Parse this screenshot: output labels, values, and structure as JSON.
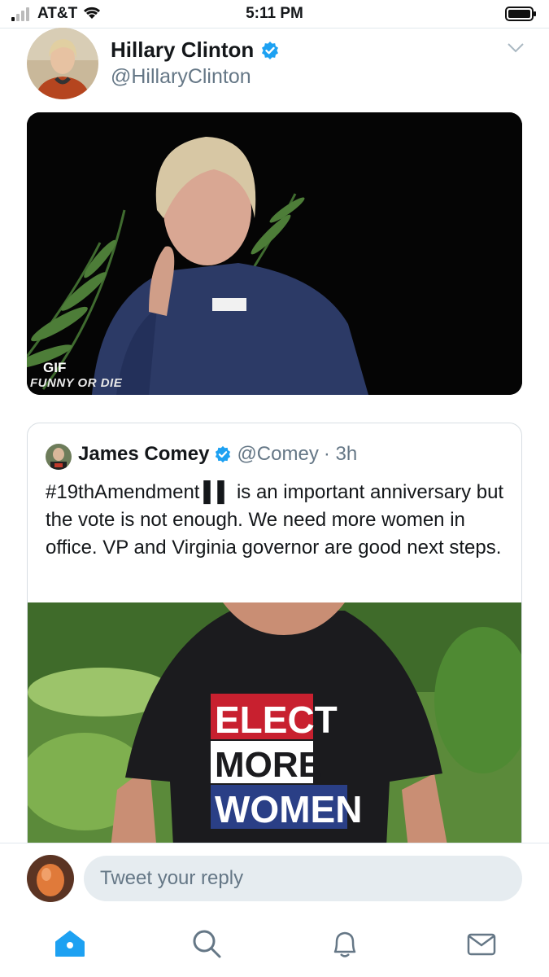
{
  "status": {
    "carrier": "AT&T",
    "time": "5:11 PM"
  },
  "tweet": {
    "author_name": "Hillary Clinton",
    "author_handle": "@HillaryClinton",
    "media": {
      "badge": "GIF",
      "watermark": "FUNNY OR DIE"
    }
  },
  "quoted": {
    "author_name": "James Comey",
    "author_handle": "@Comey",
    "time_ago": "· 3h",
    "text": "#19thAmendment ▌▌ is an important anniversary but the vote is not enough. We need more women in office. VP and Virginia governor are good next steps.",
    "shirt_lines": [
      "ELECT",
      "MORE",
      "WOMEN"
    ]
  },
  "reply": {
    "placeholder": "Tweet your reply"
  },
  "tabs": [
    "home-icon",
    "search-icon",
    "notifications-icon",
    "messages-icon"
  ],
  "colors": {
    "accent": "#1da1f2",
    "muted": "#657786"
  }
}
